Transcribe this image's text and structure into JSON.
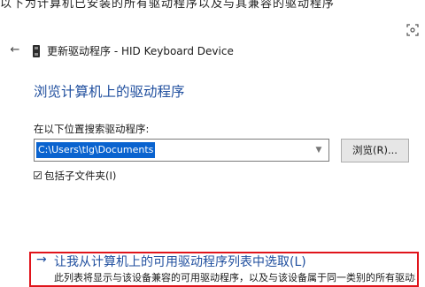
{
  "window": {
    "back_label": "←",
    "title": "更新驱动程序 - HID Keyboard Device"
  },
  "top_strip_text": "以下为计算机已安装的所有驱动程序以及与其兼容的驱动程序",
  "main": {
    "heading": "浏览计算机上的驱动程序",
    "search_label": "在以下位置搜索驱动程序:",
    "path_value": "C:\\Users\\tlg\\Documents",
    "browse_label": "浏览(R)...",
    "include_subfolders_label": "包括子文件夹(I)",
    "include_subfolders_checked": true
  },
  "pick_option": {
    "arrow": "→",
    "label": "让我从计算机上的可用驱动程序列表中选取(L)",
    "description": "此列表将显示与该设备兼容的可用驱动程序，以及与该设备属于同一类别的所有驱动程"
  },
  "colors": {
    "accent": "#1f4e9e",
    "selection": "#0a63cf",
    "highlight_border": "#e0141b"
  },
  "icons": {
    "scan": "scan-icon",
    "device": "usb-device-icon",
    "back": "back-arrow-icon"
  }
}
